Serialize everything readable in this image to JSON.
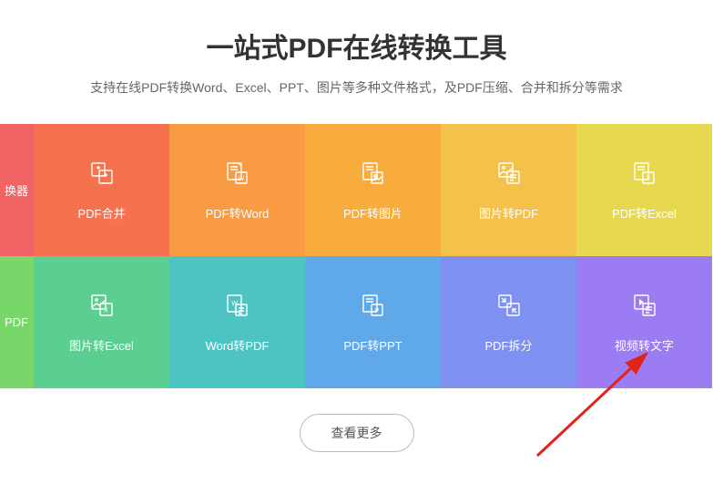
{
  "header": {
    "title": "一站式PDF在线转换工具",
    "subtitle": "支持在线PDF转换Word、Excel、PPT、图片等多种文件格式，及PDF压缩、合并和拆分等需求"
  },
  "tiles": {
    "row1": [
      {
        "label": "换器",
        "color": "#f16265",
        "icon": "converter"
      },
      {
        "label": "PDF合并",
        "color": "#f6714e",
        "icon": "merge"
      },
      {
        "label": "PDF转Word",
        "color": "#f89b43",
        "icon": "pdf-word"
      },
      {
        "label": "PDF转图片",
        "color": "#f8ac3e",
        "icon": "pdf-image"
      },
      {
        "label": "图片转PDF",
        "color": "#f4c14a",
        "icon": "image-pdf"
      },
      {
        "label": "PDF转Excel",
        "color": "#e8d850",
        "icon": "pdf-excel"
      }
    ],
    "row2": [
      {
        "label": "PDF",
        "color": "#78d66a",
        "icon": "pdf"
      },
      {
        "label": "图片转Excel",
        "color": "#5bcf91",
        "icon": "image-excel"
      },
      {
        "label": "Word转PDF",
        "color": "#4dc3c3",
        "icon": "word-pdf"
      },
      {
        "label": "PDF转PPT",
        "color": "#5fa9ea",
        "icon": "pdf-ppt"
      },
      {
        "label": "PDF拆分",
        "color": "#7e91f0",
        "icon": "split"
      },
      {
        "label": "视频转文字",
        "color": "#9c7cf2",
        "icon": "video-text"
      }
    ]
  },
  "footer": {
    "more_label": "查看更多"
  }
}
